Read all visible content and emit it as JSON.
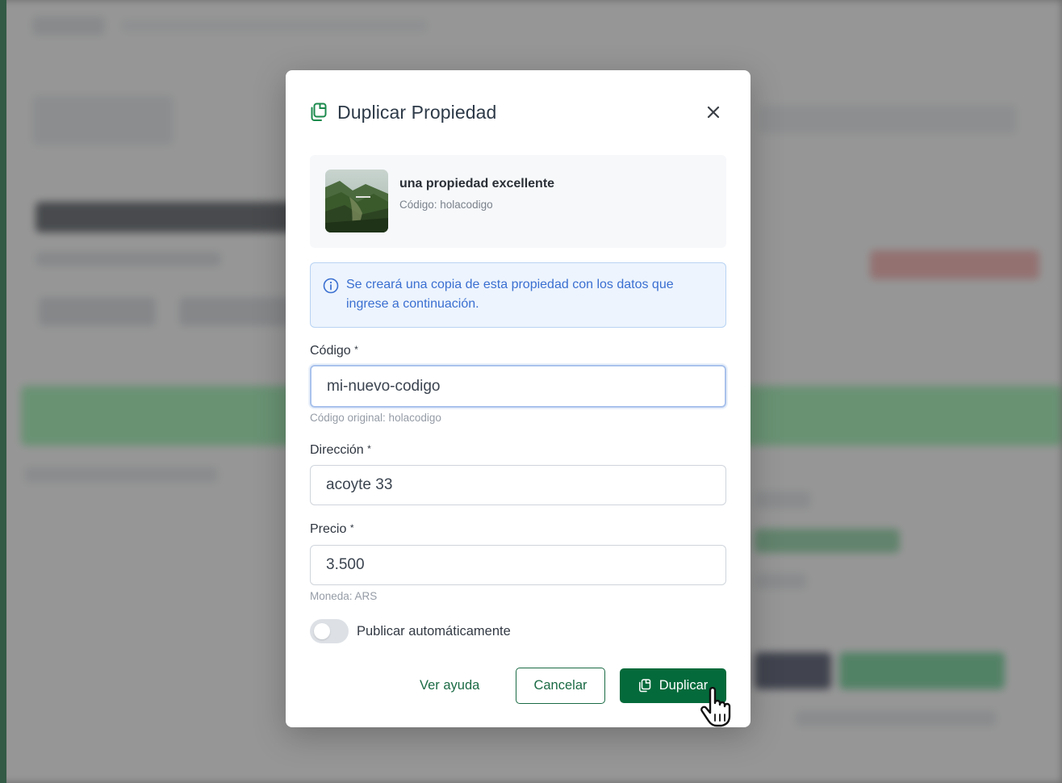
{
  "modal": {
    "title": "Duplicar Propiedad",
    "title_icon": "duplicate-icon",
    "close_icon": "close-icon"
  },
  "property": {
    "name": "una propiedad excellente",
    "code_line": "Código: holacodigo",
    "thumbnail": "mountain-landscape-photo"
  },
  "info": {
    "icon": "info-circle-icon",
    "text": "Se creará una copia de esta propiedad con los datos que ingrese a continuación."
  },
  "form": {
    "code": {
      "label": "Código",
      "required_mark": "*",
      "value": "mi-nuevo-codigo",
      "help": "Código original: holacodigo"
    },
    "address": {
      "label": "Dirección",
      "required_mark": "*",
      "value": "acoyte 33"
    },
    "price": {
      "label": "Precio",
      "required_mark": "*",
      "value": "3.500",
      "help": "Moneda: ARS"
    },
    "auto_publish": {
      "label": "Publicar automáticamente",
      "enabled": false
    }
  },
  "actions": {
    "help": "Ver ayuda",
    "cancel": "Cancelar",
    "duplicate": "Duplicar",
    "duplicate_icon": "duplicate-icon"
  },
  "colors": {
    "primary": "#046a3b",
    "info_text": "#3a6fd1",
    "info_bg": "#edf4fd",
    "info_border": "#b8d3f3",
    "title": "#2d3a48"
  }
}
